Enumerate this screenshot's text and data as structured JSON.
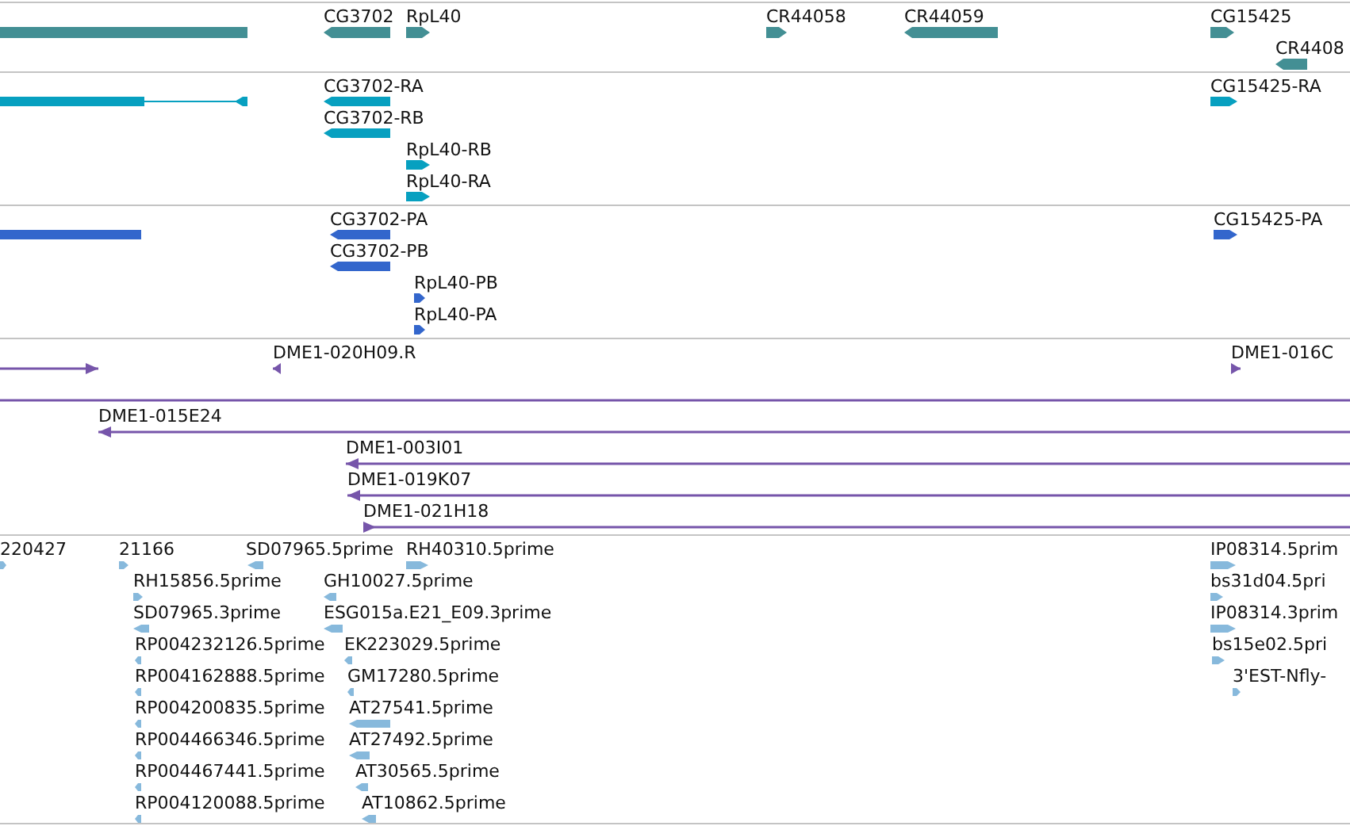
{
  "tracks": [
    {
      "kind": "gene",
      "color": "#438f94",
      "features": [
        {
          "reverse": true
        },
        {
          "label": "CG3702",
          "reverse": true
        },
        {
          "label": "RpL40",
          "reverse": false
        },
        {
          "label": "CR44058",
          "reverse": false
        },
        {
          "label": "CR44059",
          "reverse": true
        },
        {
          "label": "CG15425",
          "reverse": false
        },
        {
          "label": "CR4408",
          "reverse": true
        }
      ]
    },
    {
      "kind": "mrna",
      "color": "#07a0c0",
      "features": [
        {
          "reverse": true
        },
        {
          "label": "CG3702-RA",
          "reverse": true
        },
        {
          "label": "CG15425-RA",
          "reverse": false
        },
        {
          "label": "CG3702-RB",
          "reverse": true
        },
        {
          "label": "RpL40-RB",
          "reverse": false
        },
        {
          "label": "RpL40-RA",
          "reverse": false
        }
      ]
    },
    {
      "kind": "protein",
      "color": "#3366cc",
      "features": [
        {
          "reverse": true
        },
        {
          "label": "CG3702-PA",
          "reverse": true
        },
        {
          "label": "CG15425-PA",
          "reverse": false
        },
        {
          "label": "CG3702-PB",
          "reverse": true
        },
        {
          "label": "RpL40-PB",
          "reverse": false
        },
        {
          "label": "RpL40-PA",
          "reverse": false
        }
      ]
    },
    {
      "kind": "clone",
      "color": "#7655aa",
      "features": [
        {
          "reverse": false
        },
        {
          "label": "DME1-020H09.R",
          "reverse": true
        },
        {
          "label": "DME1-016C",
          "reverse": false
        },
        {
          "reverse": true
        },
        {
          "label": "DME1-015E24",
          "reverse": true
        },
        {
          "label": "DME1-003I01",
          "reverse": true
        },
        {
          "label": "DME1-019K07",
          "reverse": true
        },
        {
          "label": "DME1-021H18",
          "reverse": false
        }
      ]
    },
    {
      "kind": "est",
      "color": "#87b9dc",
      "features": [
        {
          "label": "220427",
          "reverse": false
        },
        {
          "label": "21166",
          "reverse": false
        },
        {
          "label": "SD07965.5prime",
          "reverse": true
        },
        {
          "label": "RH40310.5prime",
          "reverse": false
        },
        {
          "label": "IP08314.5prim",
          "reverse": false
        },
        {
          "label": "RH15856.5prime",
          "reverse": false
        },
        {
          "label": "GH10027.5prime",
          "reverse": true
        },
        {
          "label": "bs31d04.5pri",
          "reverse": false
        },
        {
          "label": "SD07965.3prime",
          "reverse": true
        },
        {
          "label": "ESG015a.E21_E09.3prime",
          "reverse": true
        },
        {
          "label": "IP08314.3prim",
          "reverse": false
        },
        {
          "label": "RP004232126.5prime",
          "reverse": true
        },
        {
          "label": "EK223029.5prime",
          "reverse": true
        },
        {
          "label": "bs15e02.5pri",
          "reverse": false
        },
        {
          "label": "RP004162888.5prime",
          "reverse": true
        },
        {
          "label": "GM17280.5prime",
          "reverse": true
        },
        {
          "label": "3'EST-Nfly-",
          "reverse": false
        },
        {
          "label": "RP004200835.5prime",
          "reverse": true
        },
        {
          "label": "AT27541.5prime",
          "reverse": true
        },
        {
          "label": "RP004466346.5prime",
          "reverse": true
        },
        {
          "label": "AT27492.5prime",
          "reverse": true
        },
        {
          "label": "RP004467441.5prime",
          "reverse": true
        },
        {
          "label": "AT30565.5prime",
          "reverse": true
        },
        {
          "label": "RP004120088.5prime",
          "reverse": true
        },
        {
          "label": "AT10862.5prime",
          "reverse": true
        }
      ]
    }
  ]
}
